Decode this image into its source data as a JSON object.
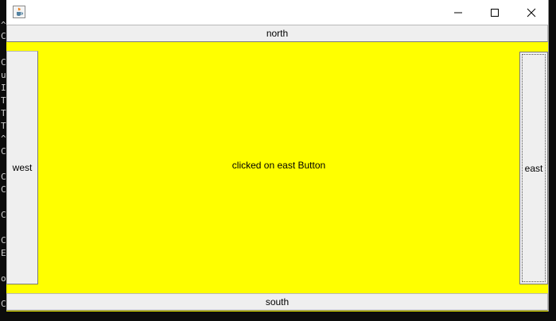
{
  "background_console": {
    "glyphs": [
      "^",
      "C",
      "",
      "C",
      "u",
      "I",
      "T",
      "T",
      "T",
      "^",
      "C",
      "",
      "C",
      "C",
      "",
      "C",
      "",
      "C",
      "E",
      "",
      "o",
      "",
      "C"
    ]
  },
  "window": {
    "title": "",
    "icon": "java-cup-icon",
    "controls": {
      "minimize": "minimize-icon",
      "maximize": "maximize-icon",
      "close": "close-icon"
    }
  },
  "layout": {
    "north_label": "north",
    "south_label": "south",
    "west_label": "west",
    "east_label": "east",
    "center_text": "clicked on east Button"
  },
  "colors": {
    "center_background": "#ffff00",
    "button_background": "#efefef",
    "titlebar": "#ffffff"
  }
}
